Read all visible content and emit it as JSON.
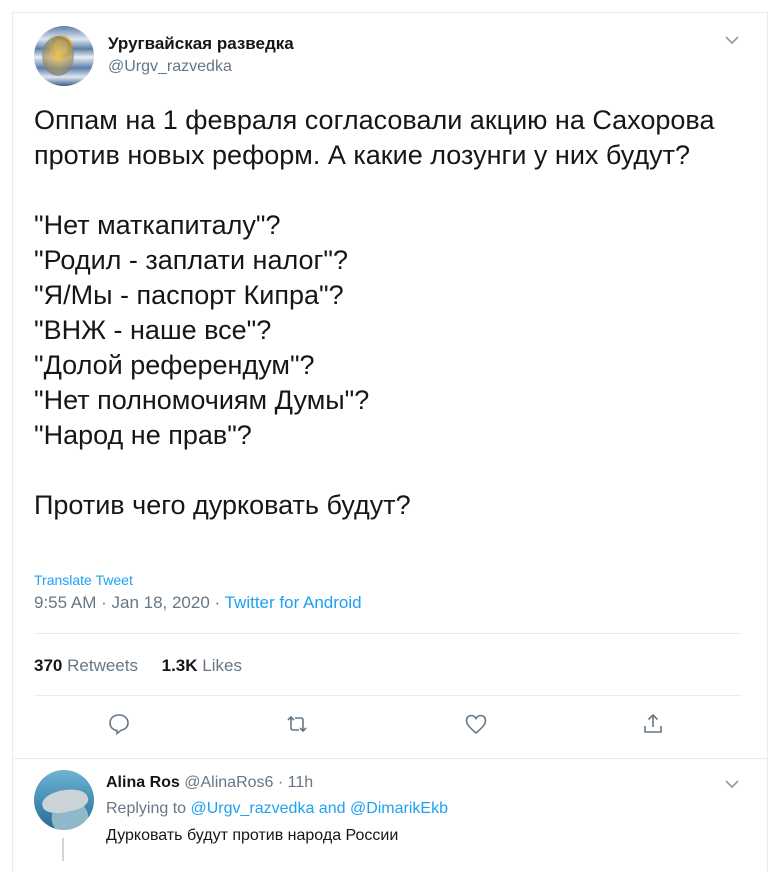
{
  "tweet": {
    "author_name": "Уругвайская разведка",
    "author_handle": "@Urgv_razvedka",
    "text": "Оппам на 1 февраля согласовали акцию на Сахорова\nпротив новых реформ. А какие лозунги у них будут?\n\n\"Нет маткапиталу\"?\n\"Родил - заплати налог\"?\n\"Я/Мы - паспорт Кипра\"?\n\"ВНЖ - наше все\"?\n\"Долой референдум\"?\n\"Нет полномочиям Думы\"?\n\"Народ не прав\"?\n\nПротив чего дурковать будут?",
    "translate_label": "Translate Tweet",
    "time": "9:55 AM",
    "date": "Jan 18, 2020",
    "source": "Twitter for Android",
    "retweets_count": "370",
    "retweets_label": "Retweets",
    "likes_count": "1.3K",
    "likes_label": "Likes",
    "actions": [
      "reply-icon",
      "retweet-icon",
      "like-icon",
      "share-icon"
    ]
  },
  "reply": {
    "author_name": "Alina Ros",
    "author_handle": "@AlinaRos6",
    "time": "11h",
    "replying_prefix": "Replying to",
    "replying_user1": "@Urgv_razvedka",
    "replying_and": "and",
    "replying_user2": "@DimarikEkb",
    "text": "Дурковать будут против народа России"
  },
  "colors": {
    "accent": "#1da1f2",
    "secondary_text": "#657786",
    "primary_text": "#14171a",
    "divider": "#e6ecf0"
  }
}
